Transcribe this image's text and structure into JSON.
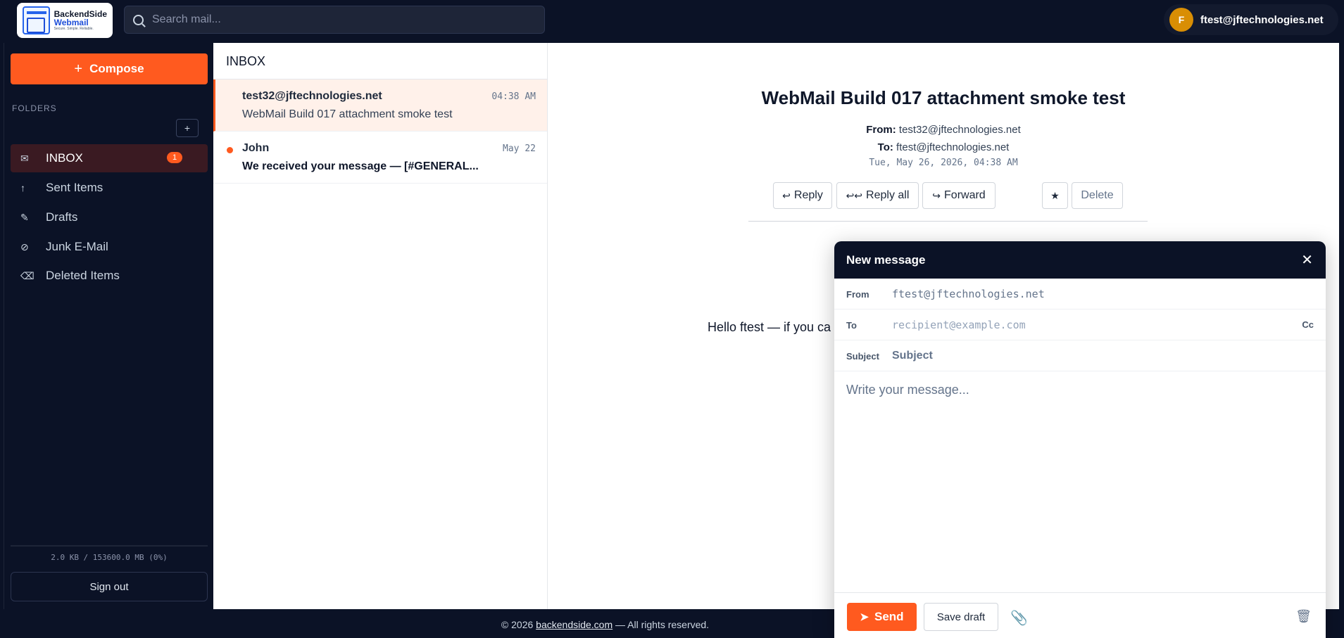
{
  "app": {
    "logo_line1": "BackendSide",
    "logo_line2": "Webmail",
    "logo_tagline": "Secure. Simple. Reliable."
  },
  "search": {
    "placeholder": "Search mail...",
    "icon": "search-icon"
  },
  "user": {
    "initial": "F",
    "email": "ftest@jftechnologies.net"
  },
  "sidebar": {
    "compose_label": "Compose",
    "folders_heading": "FOLDERS",
    "add_folder_label": "+",
    "folders": [
      {
        "label": "INBOX",
        "icon": "mail-icon",
        "glyph": "✉",
        "count": "1",
        "active": true
      },
      {
        "label": "Sent Items",
        "icon": "arrow-up-icon",
        "glyph": "↑"
      },
      {
        "label": "Drafts",
        "icon": "pencil-icon",
        "glyph": "✎"
      },
      {
        "label": "Junk E-Mail",
        "icon": "block-icon",
        "glyph": "⊘"
      },
      {
        "label": "Deleted Items",
        "icon": "erase-icon",
        "glyph": "⌫"
      }
    ],
    "quota": "2.0 KB / 153600.0 MB (0%)",
    "signout_label": "Sign out"
  },
  "list": {
    "title": "INBOX",
    "messages": [
      {
        "from": "test32@jftechnologies.net",
        "date": "04:38 AM",
        "subject": "WebMail Build 017 attachment smoke test",
        "selected": true,
        "unread": false
      },
      {
        "from": "John",
        "date": "May 22",
        "subject": "We received your message — [#GENERAL...",
        "selected": false,
        "unread": true
      }
    ]
  },
  "reader": {
    "subject": "WebMail Build 017 attachment smoke test",
    "from_label": "From:",
    "from": "test32@jftechnologies.net",
    "to_label": "To:",
    "to": "ftest@jftechnologies.net",
    "date": "Tue, May 26, 2026, 04:38 AM",
    "reply_label": "Reply",
    "reply_all_label": "Reply all",
    "forward_label": "Forward",
    "star_label": "★",
    "delete_label": "Delete",
    "body_visible": "Hello ftest — if you ca"
  },
  "compose": {
    "title": "New message",
    "close": "✕",
    "from_label": "From",
    "from_value": "ftest@jftechnologies.net",
    "to_label": "To",
    "to_placeholder": "recipient@example.com",
    "cc_label": "Cc",
    "subject_label": "Subject",
    "subject_placeholder": "Subject",
    "body_placeholder": "Write your message...",
    "send_label": "Send",
    "save_draft_label": "Save draft"
  },
  "footer": {
    "prefix": "© 2026 ",
    "link": "backendside.com",
    "suffix": " — All rights reserved."
  },
  "colors": {
    "accent": "#ff5a1f",
    "nav_bg": "#0b1226",
    "active_folder_bg": "#3a1a22",
    "avatar": "#d98e04"
  }
}
